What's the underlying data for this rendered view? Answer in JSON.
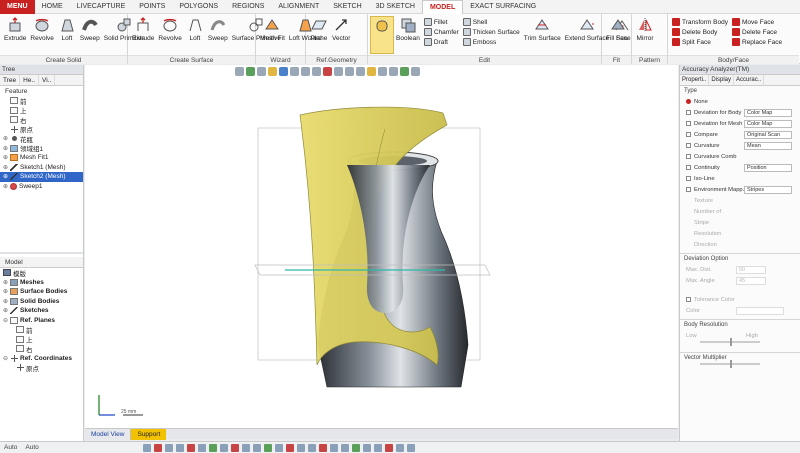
{
  "menu": {
    "main_button": "MENU",
    "tabs": [
      "HOME",
      "LIVECAPTURE",
      "POINTS",
      "POLYGONS",
      "REGIONS",
      "ALIGNMENT",
      "SKETCH",
      "3D SKETCH",
      "MODEL",
      "EXACT SURFACING"
    ],
    "active_tab": "MODEL"
  },
  "ribbon": {
    "create_solid": {
      "label": "Create Solid",
      "buttons": [
        "Extrude",
        "Revolve",
        "Loft",
        "Sweep",
        "Solid Primitive"
      ]
    },
    "create_surface": {
      "label": "Create Surface",
      "buttons": [
        "Extrude",
        "Revolve",
        "Loft",
        "Sweep",
        "Surface Primitive"
      ]
    },
    "wizard": {
      "label": "Wizard",
      "buttons": [
        "Mesh Fit",
        "Loft Wizard"
      ]
    },
    "ref_geometry": {
      "label": "Ref.Geometry",
      "buttons": [
        "Plane",
        "Vector"
      ]
    },
    "edit": {
      "label": "Edit",
      "big_buttons": [
        "Boolean"
      ],
      "small_col1": [
        "Fillet",
        "Chamfer",
        "Draft"
      ],
      "small_col2": [
        "Shell",
        "Thicken Surface",
        "Emboss"
      ],
      "buttons": [
        "Trim Surface",
        "Extend Surface",
        "Sew"
      ]
    },
    "fit": {
      "label": "Fit",
      "buttons": [
        "Fill Face"
      ]
    },
    "pattern": {
      "label": "Pattern",
      "buttons": [
        "Mirror"
      ]
    },
    "body_face": {
      "label": "Body/Face",
      "col1": [
        "Transform Body",
        "Delete Body",
        "Split Face"
      ],
      "col2": [
        "Move Face",
        "Delete Face",
        "Replace Face"
      ]
    }
  },
  "tree_panel": {
    "title": "Tree",
    "tabs": [
      "Tree",
      "He..",
      "Vi.."
    ],
    "section": "Feature",
    "items": [
      {
        "label": "前",
        "icon": "plane-icon"
      },
      {
        "label": "上",
        "icon": "plane-icon"
      },
      {
        "label": "右",
        "icon": "plane-icon"
      },
      {
        "label": "原点",
        "icon": "origin-icon"
      },
      {
        "label": "花瓶",
        "icon": "point-icon"
      },
      {
        "label": "领域组1",
        "icon": "region-group-icon"
      },
      {
        "label": "Mesh Fit1",
        "icon": "mesh-fit-icon"
      },
      {
        "label": "Sketch1 (Mesh)",
        "icon": "sketch-icon"
      },
      {
        "label": "Sketch2 (Mesh)",
        "icon": "sketch-icon",
        "selected": true
      },
      {
        "label": "Sweep1",
        "icon": "sweep-icon"
      }
    ]
  },
  "model_panel": {
    "title": "Model",
    "root": "模版",
    "items": [
      {
        "label": "Meshes"
      },
      {
        "label": "Surface Bodies"
      },
      {
        "label": "Solid Bodies"
      },
      {
        "label": "Sketches"
      },
      {
        "label": "Ref. Planes"
      },
      {
        "label": "前",
        "sub": true
      },
      {
        "label": "上",
        "sub": true
      },
      {
        "label": "右",
        "sub": true
      },
      {
        "label": "Ref. Coordinates"
      },
      {
        "label": "原点",
        "sub": true
      }
    ]
  },
  "viewport": {
    "scale_label": "25 mm",
    "bottom_tabs": [
      "Model View",
      "Support"
    ]
  },
  "accuracy_panel": {
    "title": "Accuracy Analyzer(TM)",
    "tabs": [
      "Properti..",
      "Display",
      "Accurac.."
    ],
    "type_label": "Type",
    "options": [
      {
        "label": "None",
        "checked": true
      },
      {
        "label": "Deviation for Body",
        "value": "Color Map"
      },
      {
        "label": "Deviation for Mesh",
        "value": "Color Map"
      },
      {
        "label": "Compare",
        "value": "Original Scan"
      },
      {
        "label": "Curvature",
        "value": "Mean"
      },
      {
        "label": "Curvature Comb",
        "value": ""
      },
      {
        "label": "Continuity",
        "value": "Position"
      },
      {
        "label": "Iso-Line",
        "value": ""
      },
      {
        "label": "Environment Mapp...",
        "value": "Stripes"
      }
    ],
    "dim_rows": [
      "Texture",
      "Number of",
      "Stripe",
      "Resolution",
      "Direction"
    ],
    "deviation_option": "Deviation Option",
    "max_dist_label": "Max. Dist.",
    "max_dist_value": "50",
    "max_angle_label": "Max. Angle",
    "max_angle_value": "45",
    "tolerance_label": "Tolerance Color",
    "color_label": "Color",
    "body_resolution": "Body Resolution",
    "low_high": [
      "Low",
      "High"
    ],
    "vector_multiplier": "Vector Multiplier"
  },
  "statusbar": {
    "left": "Auto",
    "left2": "Auto"
  }
}
